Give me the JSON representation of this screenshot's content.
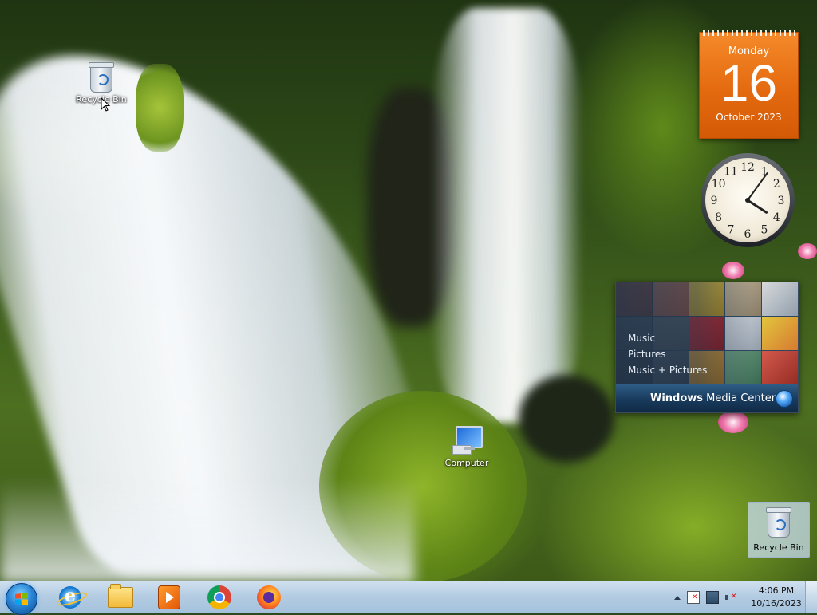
{
  "desktop": {
    "icons": [
      {
        "id": "recycle-bin",
        "label": "Recycle Bin"
      },
      {
        "id": "computer",
        "label": "Computer"
      }
    ],
    "recycle_bin_right_label": "Recycle Bin"
  },
  "gadgets": {
    "calendar": {
      "weekday": "Monday",
      "day": "16",
      "month_year": "October 2023",
      "color": "#e46a10"
    },
    "clock": {
      "hour": 4,
      "minute": 6,
      "numerals": [
        "12",
        "1",
        "2",
        "3",
        "4",
        "5",
        "6",
        "7",
        "8",
        "9",
        "10",
        "11"
      ]
    },
    "media_center": {
      "menu": [
        "Music",
        "Pictures",
        "Music + Pictures"
      ],
      "brand_bold": "Windows",
      "brand_rest": " Media Center"
    }
  },
  "taskbar": {
    "start_icon": "windows-orb",
    "pinned": [
      {
        "id": "internet-explorer",
        "icon": "ie-icon"
      },
      {
        "id": "file-explorer",
        "icon": "folder-icon"
      },
      {
        "id": "media-player",
        "icon": "media-player-icon"
      },
      {
        "id": "chrome",
        "icon": "chrome-icon"
      },
      {
        "id": "firefox",
        "icon": "firefox-icon"
      }
    ],
    "tray": {
      "icons": [
        "show-hidden-icons",
        "action-center-flag-icon",
        "network-icon",
        "volume-muted-icon"
      ],
      "time": "4:06 PM",
      "date": "10/16/2023"
    }
  },
  "colors": {
    "taskbar": "#b5cde3",
    "accent": "#2a86d6"
  }
}
